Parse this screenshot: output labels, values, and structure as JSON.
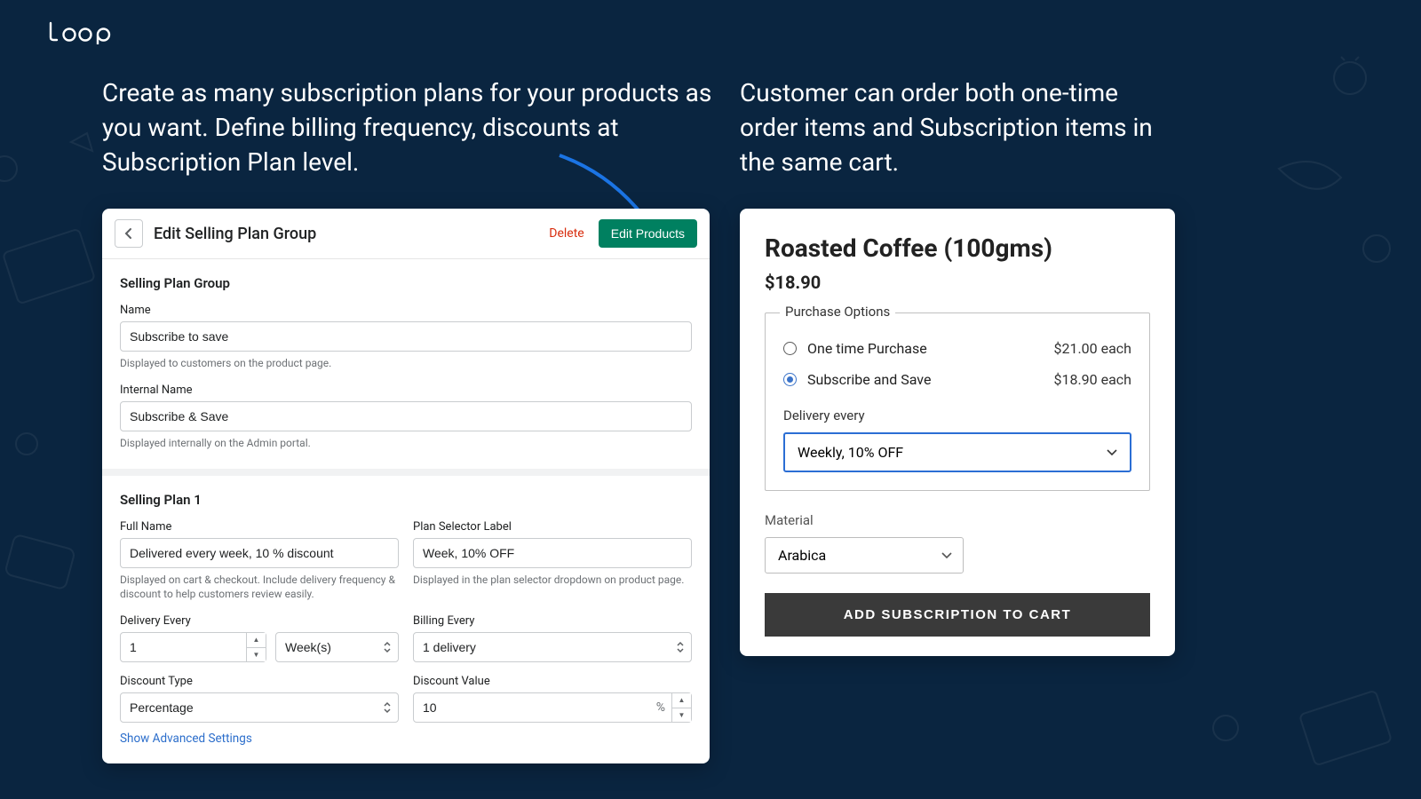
{
  "logo_text": "Loop",
  "headlines": {
    "left": "Create as many subscription plans for your products as you want. Define billing frequency, discounts at Subscription Plan level.",
    "right": "Customer can order both one-time order items and Subscription items in the same cart."
  },
  "admin": {
    "page_title": "Edit Selling Plan Group",
    "delete_label": "Delete",
    "edit_products_label": "Edit Products",
    "group_section_title": "Selling Plan Group",
    "name_label": "Name",
    "name_value": "Subscribe to save",
    "name_help": "Displayed to customers on the product page.",
    "internal_label": "Internal Name",
    "internal_value": "Subscribe & Save",
    "internal_help": "Displayed internally on the Admin portal.",
    "plan1_title": "Selling Plan 1",
    "fullname_label": "Full Name",
    "fullname_value": "Delivered every week, 10 % discount",
    "fullname_help": "Displayed on cart & checkout. Include delivery frequency & discount to help customers review easily.",
    "selector_label": "Plan Selector Label",
    "selector_value": "Week, 10% OFF",
    "selector_help": "Displayed in the plan selector dropdown on product page.",
    "delivery_every_label": "Delivery Every",
    "delivery_num": "1",
    "delivery_unit": "Week(s)",
    "billing_every_label": "Billing Every",
    "billing_value": "1 delivery",
    "discount_type_label": "Discount Type",
    "discount_type_value": "Percentage",
    "discount_value_label": "Discount Value",
    "discount_value": "10",
    "discount_value_suffix": "%",
    "show_advanced": "Show Advanced Settings"
  },
  "product": {
    "title": "Roasted Coffee (100gms)",
    "price": "$18.90",
    "purchase_options_label": "Purchase Options",
    "opt_once_label": "One time Purchase",
    "opt_once_price": "$21.00 each",
    "opt_sub_label": "Subscribe and Save",
    "opt_sub_price": "$18.90 each",
    "delivery_every_label": "Delivery every",
    "delivery_every_value": "Weekly, 10% OFF",
    "material_label": "Material",
    "material_value": "Arabica",
    "cart_button": "ADD SUBSCRIPTION TO CART"
  }
}
